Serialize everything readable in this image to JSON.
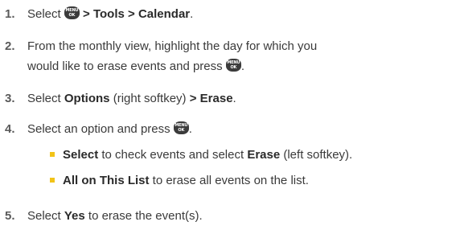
{
  "steps": [
    {
      "num": "1.",
      "pre": "Select",
      "key": {
        "line1": "MENU",
        "line2": "OK"
      },
      "bold": " > Tools > Calendar",
      "post": "."
    },
    {
      "num": "2.",
      "line1": "From the monthly view, highlight the day for which you",
      "line2_pre": "would like to erase events and press",
      "key": {
        "line1": "MENU",
        "line2": "OK"
      },
      "line2_post": "."
    },
    {
      "num": "3.",
      "pre": "Select ",
      "bold1": "Options",
      "mid": " (right softkey) ",
      "bold2": "> Erase",
      "post": "."
    },
    {
      "num": "4.",
      "pre": "Select an option and press",
      "key": {
        "line1": "MENU",
        "line2": "OK"
      },
      "post": "."
    },
    {
      "num": "5.",
      "pre": "Select ",
      "bold": "Yes",
      "post": " to erase the event(s)."
    }
  ],
  "bullets": [
    {
      "bold": "Select",
      "mid": " to check events and select ",
      "bold2": "Erase",
      "post": " (left softkey)."
    },
    {
      "bold": "All on This List",
      "post": " to erase all events on the list."
    }
  ],
  "colors": {
    "text": "#3a3a3a",
    "bullet": "#f2c318",
    "key_bg": "#3b3b3b"
  },
  "icons": [
    "menu-ok-key-icon",
    "bullet-square-icon"
  ]
}
